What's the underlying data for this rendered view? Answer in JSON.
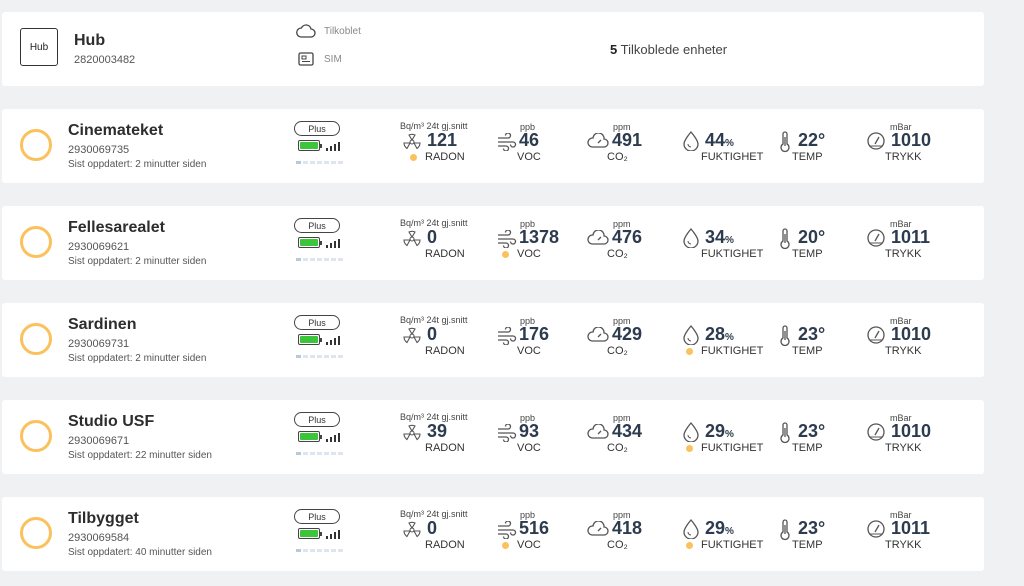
{
  "hub": {
    "icon_label": "Hub",
    "name": "Hub",
    "serial": "2820003482",
    "connection_status": "Tilkoblet",
    "sim_label": "SIM",
    "connected_count": "5",
    "connected_label": "Tilkoblede enheter"
  },
  "labels": {
    "radon_unit": "Bq/m³ 24t gj.snitt",
    "radon": "RADON",
    "voc_unit": "ppb",
    "voc": "VOC",
    "co2_unit": "ppm",
    "co2": "CO₂",
    "humidity_pct": "%",
    "humidity": "FUKTIGHET",
    "temp_unit": "°",
    "temp": "TEMP",
    "pressure_unit": "mBar",
    "pressure": "TRYKK"
  },
  "colors": {
    "status_warning": "#fbc15c",
    "battery_ok": "#3cc43a"
  },
  "devices": [
    {
      "name": "Cinemateket",
      "serial": "2930069735",
      "updated": "Sist oppdatert: 2 minutter siden",
      "plan": "Plus",
      "battery_level": 1.0,
      "radon": "121",
      "voc": "46",
      "co2": "491",
      "humidity": "44",
      "temp": "22",
      "pressure": "1010",
      "warn": {
        "radon": true,
        "voc": false,
        "humidity": false
      }
    },
    {
      "name": "Fellesarealet",
      "serial": "2930069621",
      "updated": "Sist oppdatert: 2 minutter siden",
      "plan": "Plus",
      "battery_level": 1.0,
      "radon": "0",
      "voc": "1378",
      "co2": "476",
      "humidity": "34",
      "temp": "20",
      "pressure": "1011",
      "warn": {
        "radon": false,
        "voc": true,
        "humidity": false
      }
    },
    {
      "name": "Sardinen",
      "serial": "2930069731",
      "updated": "Sist oppdatert: 2 minutter siden",
      "plan": "Plus",
      "battery_level": 1.0,
      "radon": "0",
      "voc": "176",
      "co2": "429",
      "humidity": "28",
      "temp": "23",
      "pressure": "1010",
      "warn": {
        "radon": false,
        "voc": false,
        "humidity": true
      }
    },
    {
      "name": "Studio USF",
      "serial": "2930069671",
      "updated": "Sist oppdatert: 22 minutter siden",
      "plan": "Plus",
      "battery_level": 1.0,
      "radon": "39",
      "voc": "93",
      "co2": "434",
      "humidity": "29",
      "temp": "23",
      "pressure": "1010",
      "warn": {
        "radon": false,
        "voc": false,
        "humidity": true
      }
    },
    {
      "name": "Tilbygget",
      "serial": "2930069584",
      "updated": "Sist oppdatert: 40 minutter siden",
      "plan": "Plus",
      "battery_level": 1.0,
      "radon": "0",
      "voc": "516",
      "co2": "418",
      "humidity": "29",
      "temp": "23",
      "pressure": "1011",
      "warn": {
        "radon": false,
        "voc": true,
        "humidity": true
      }
    }
  ]
}
